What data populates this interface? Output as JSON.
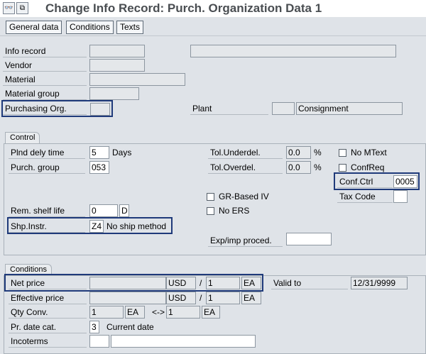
{
  "title": "Change Info Record: Purch. Organization Data 1",
  "toolbar": {
    "general_data": "General data",
    "conditions": "Conditions",
    "texts": "Texts"
  },
  "header": {
    "info_record": "Info record",
    "vendor": "Vendor",
    "material": "Material",
    "material_group": "Material group",
    "purchasing_org": "Purchasing Org.",
    "plant": "Plant",
    "plant_desc": "Consignment"
  },
  "control": {
    "title": "Control",
    "plnd_dely_time": {
      "label": "Plnd dely time",
      "value": "5",
      "unit": "Days"
    },
    "purch_group": {
      "label": "Purch. group",
      "value": "053"
    },
    "tol_underdel": {
      "label": "Tol.Underdel.",
      "value": "0.0",
      "unit": "%"
    },
    "tol_overdel": {
      "label": "Tol.Overdel.",
      "value": "0.0",
      "unit": "%"
    },
    "no_mtext": "No MText",
    "confreq": "ConfReq",
    "conf_ctrl": {
      "label": "Conf.Ctrl",
      "value": "0005"
    },
    "tax_code": {
      "label": "Tax Code",
      "value": ""
    },
    "gr_based_iv": "GR-Based IV",
    "no_ers": "No ERS",
    "rem_shelf_life": {
      "label": "Rem. shelf life",
      "value": "0",
      "unit": "D"
    },
    "shp_instr": {
      "label": "Shp.Instr.",
      "value": "Z4",
      "desc": "No ship method"
    },
    "exp_imp_proced": {
      "label": "Exp/imp proced.",
      "value": ""
    }
  },
  "conditions": {
    "title": "Conditions",
    "net_price": {
      "label": "Net price",
      "value": "",
      "currency": "USD",
      "slash": "/",
      "per": "1",
      "unit": "EA"
    },
    "valid_to": {
      "label": "Valid to",
      "value": "12/31/9999"
    },
    "effective_price": {
      "label": "Effective price",
      "value": "",
      "currency": "USD",
      "slash": "/",
      "per": "1",
      "unit": "EA"
    },
    "qty_conv": {
      "label": "Qty Conv.",
      "value1": "1",
      "unit1": "EA",
      "arrow": "<->",
      "value2": "1",
      "unit2": "EA"
    },
    "pr_date_cat": {
      "label": "Pr. date cat.",
      "value": "3",
      "desc": "Current date"
    },
    "incoterms": {
      "label": "Incoterms",
      "value1": "",
      "value2": ""
    }
  }
}
